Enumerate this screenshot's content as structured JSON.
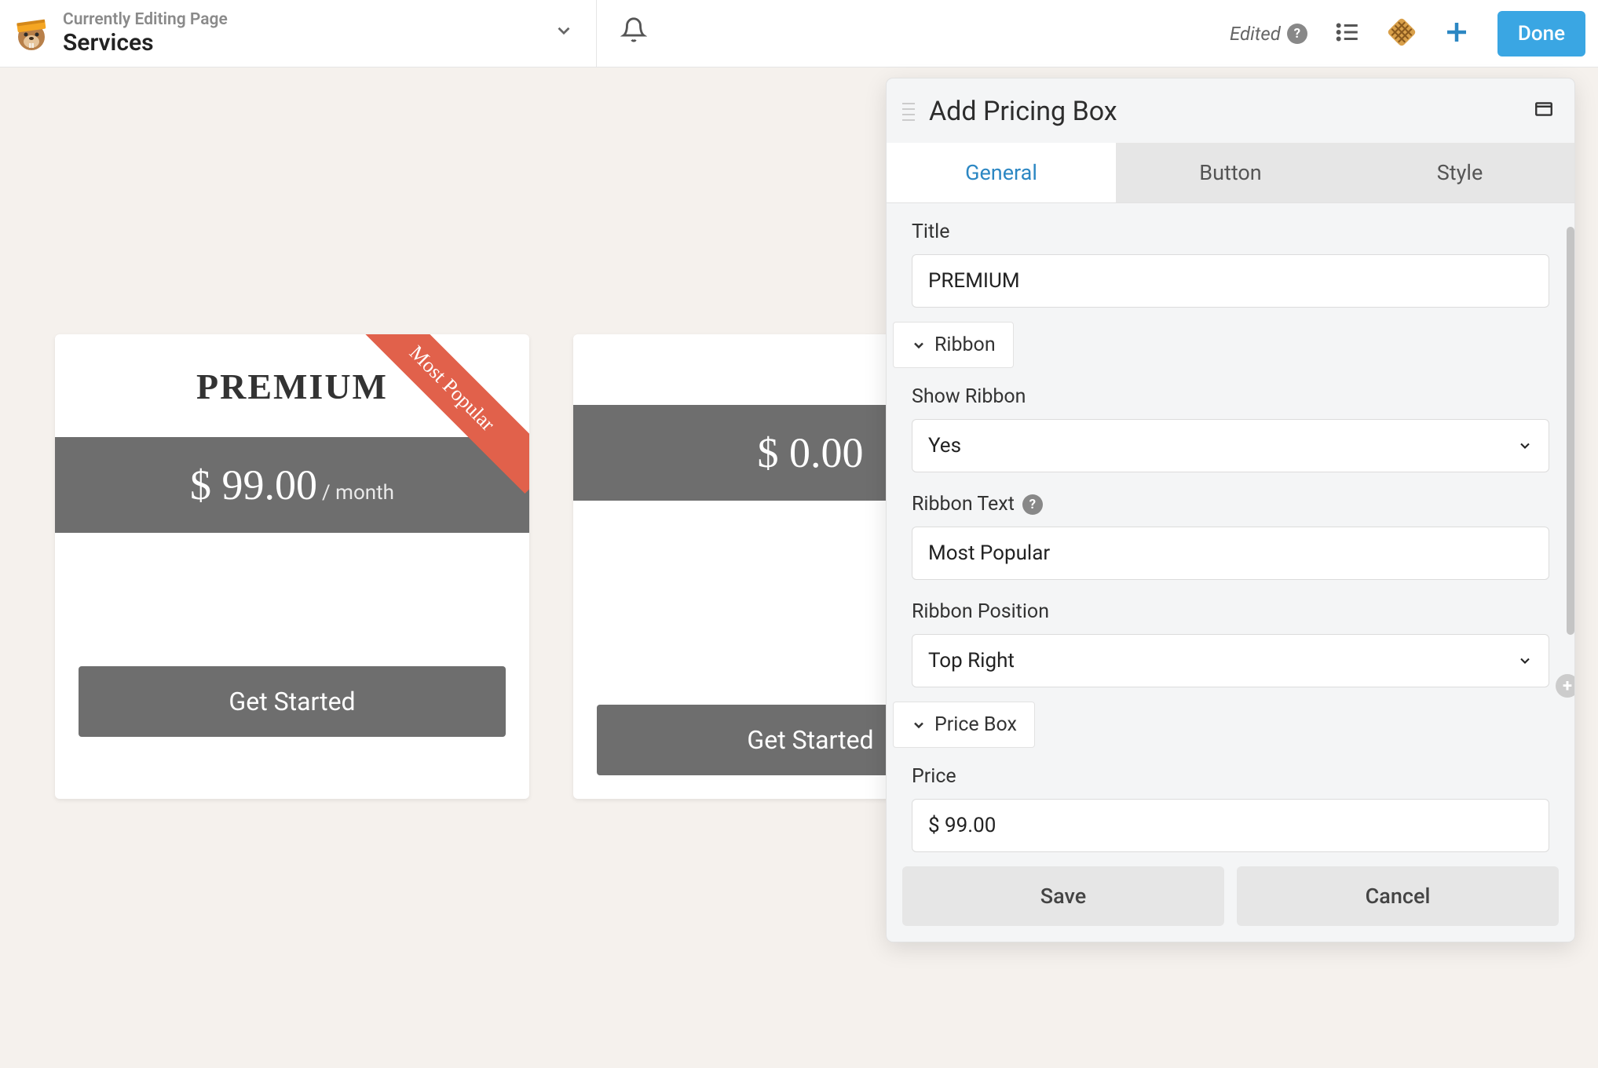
{
  "topbar": {
    "subtitle": "Currently Editing Page",
    "title": "Services",
    "edited_label": "Edited",
    "done_label": "Done"
  },
  "canvas": {
    "cards": [
      {
        "title": "PREMIUM",
        "price": "$ 99.00",
        "per": "/ month",
        "button": "Get Started",
        "ribbon": "Most Popular"
      },
      {
        "title": "",
        "price": "$ 0.00",
        "per": "",
        "button": "Get Started",
        "ribbon": ""
      }
    ]
  },
  "panel": {
    "header": "Add Pricing Box",
    "tabs": {
      "general": "General",
      "button": "Button",
      "style": "Style"
    },
    "fields": {
      "title_label": "Title",
      "title_value": "PREMIUM",
      "section_ribbon": "Ribbon",
      "show_ribbon_label": "Show Ribbon",
      "show_ribbon_value": "Yes",
      "ribbon_text_label": "Ribbon Text",
      "ribbon_text_value": "Most Popular",
      "ribbon_position_label": "Ribbon Position",
      "ribbon_position_value": "Top Right",
      "section_pricebox": "Price Box",
      "price_label": "Price",
      "price_value": "$ 99.00"
    },
    "footer": {
      "save": "Save",
      "cancel": "Cancel"
    }
  }
}
